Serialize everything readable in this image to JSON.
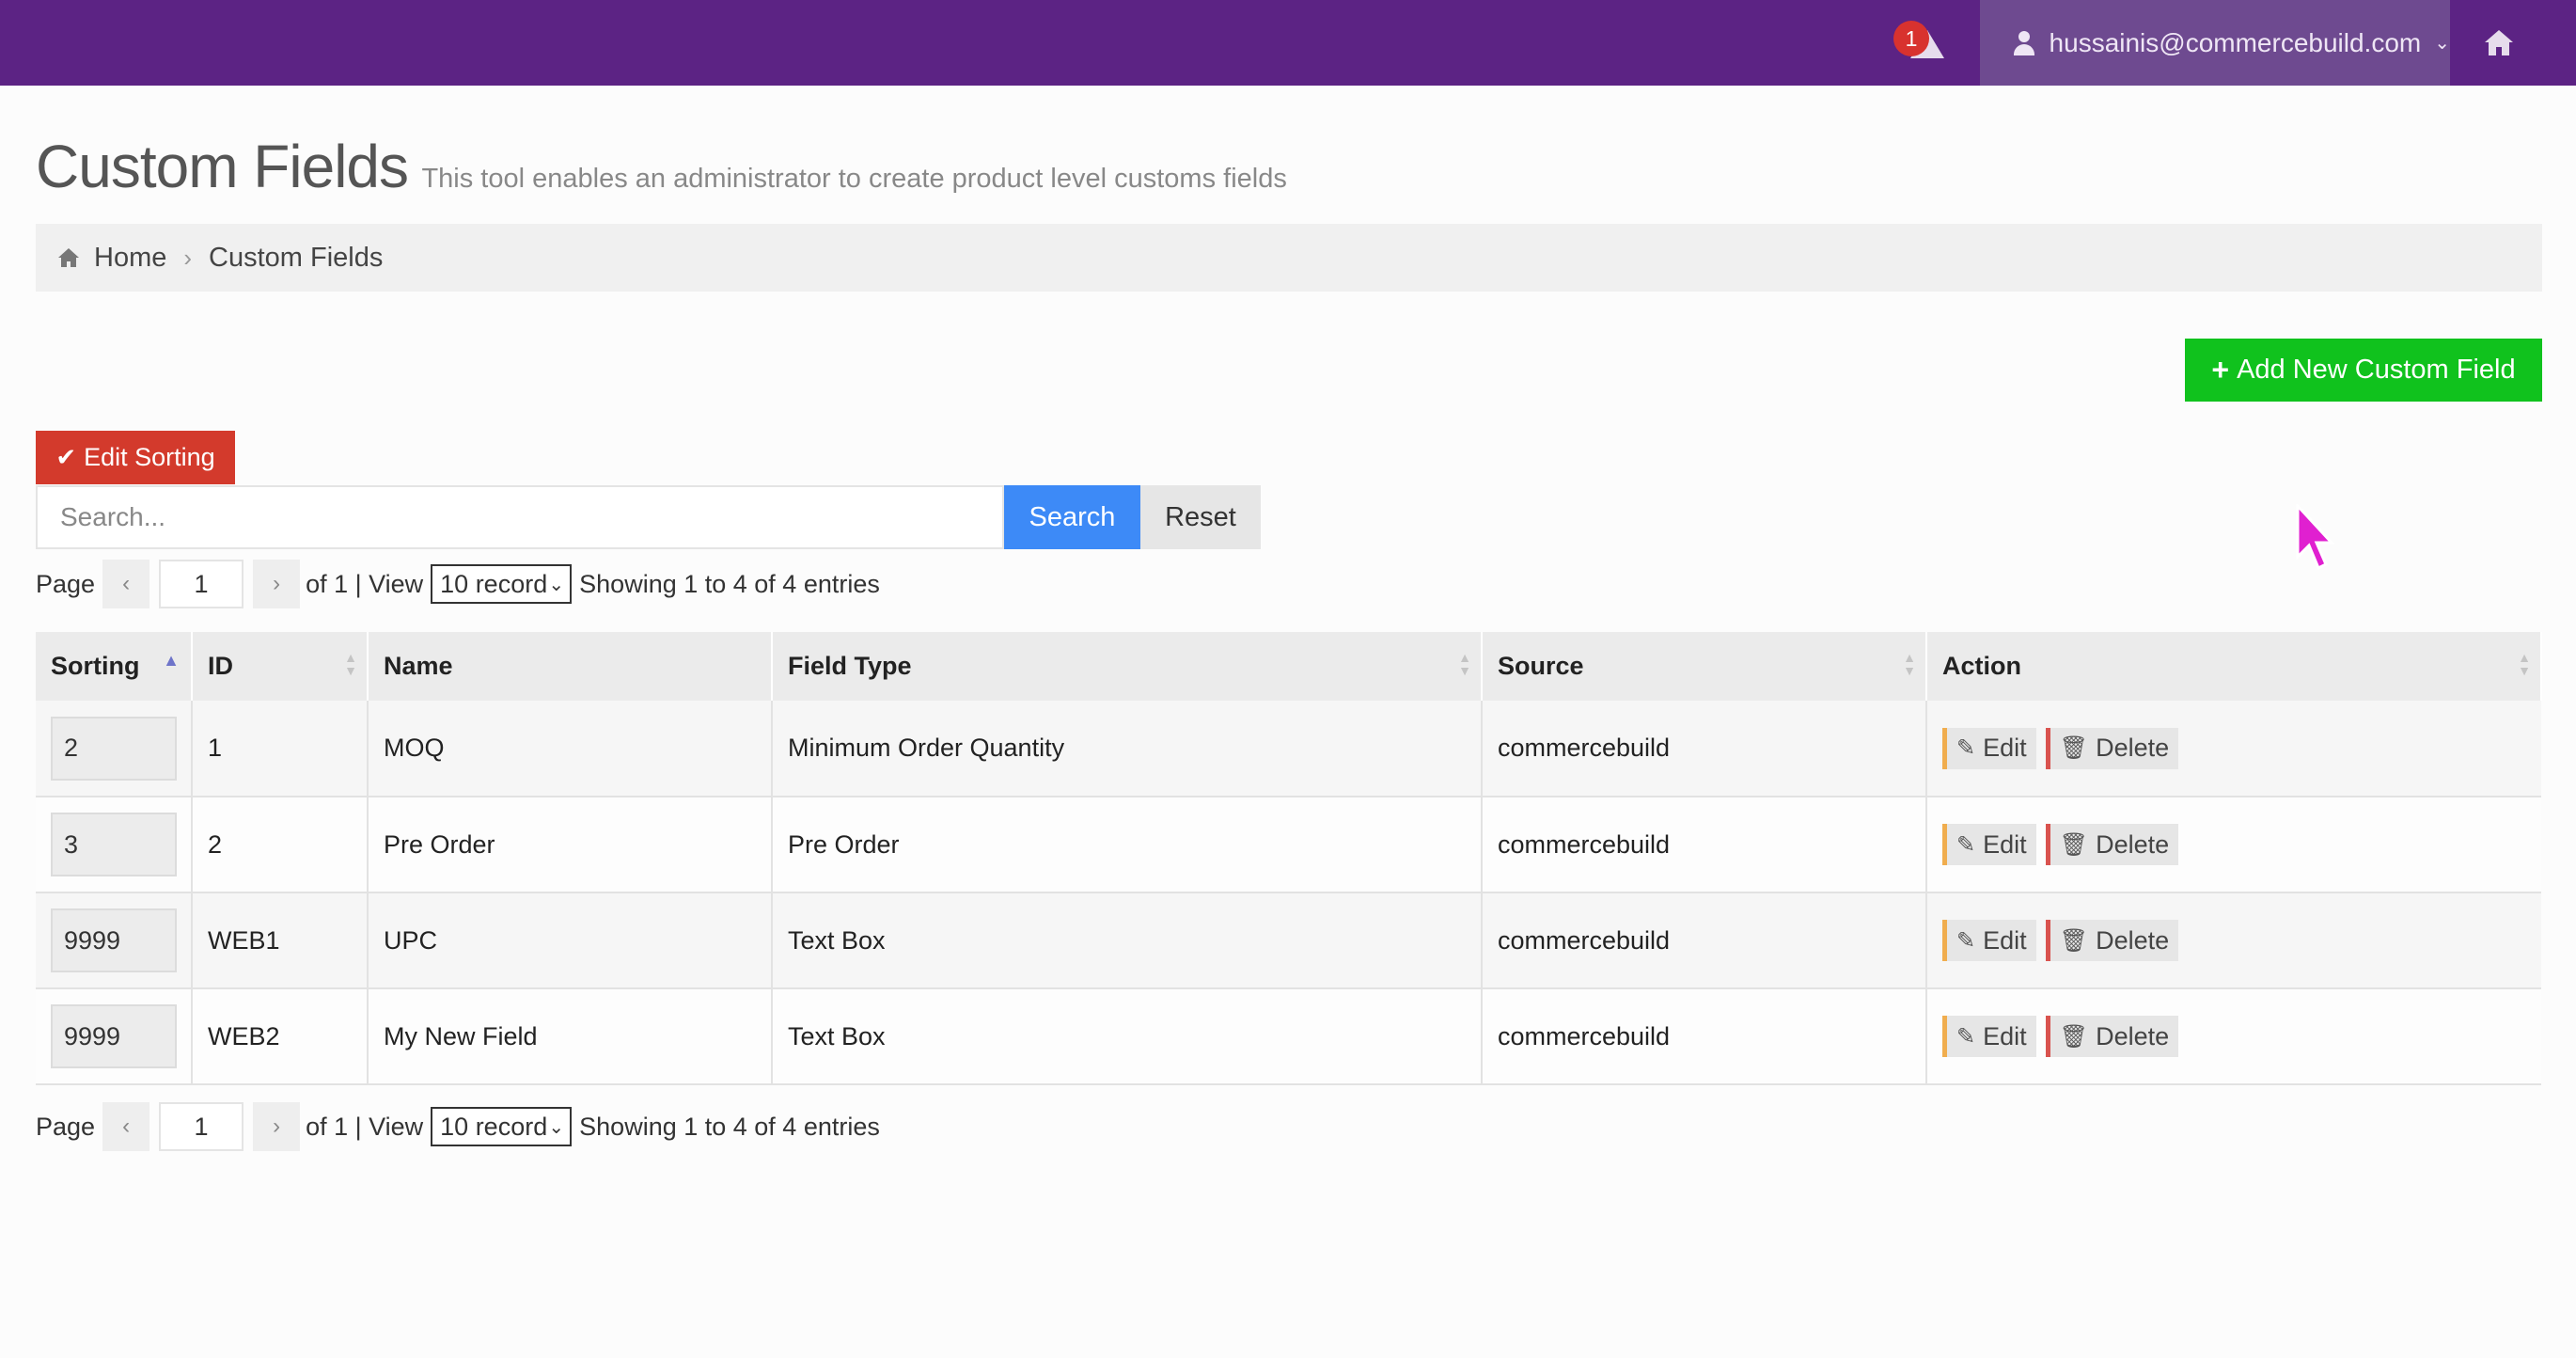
{
  "topbar": {
    "notification_count": "1",
    "user_email": "hussainis@commercebuild.com"
  },
  "page": {
    "title": "Custom Fields",
    "subtitle": "This tool enables an administrator to create product level customs fields"
  },
  "breadcrumb": {
    "home": "Home",
    "current": "Custom Fields"
  },
  "toolbar": {
    "add_label": "Add New Custom Field",
    "edit_sorting_label": "Edit Sorting",
    "search_placeholder": "Search...",
    "search_label": "Search",
    "reset_label": "Reset"
  },
  "pager": {
    "page_label": "Page",
    "prev": "‹",
    "next": "›",
    "current_page": "1",
    "of_text": "of 1 | View",
    "records_option": "10 records",
    "showing_text": "Showing 1 to 4 of 4 entries"
  },
  "table": {
    "columns": [
      "Sorting",
      "ID",
      "Name",
      "Field Type",
      "Source",
      "Action"
    ],
    "rows": [
      {
        "sorting": "2",
        "id": "1",
        "name": "MOQ",
        "field_type": "Minimum Order Quantity",
        "source": "commercebuild"
      },
      {
        "sorting": "3",
        "id": "2",
        "name": "Pre Order",
        "field_type": "Pre Order",
        "source": "commercebuild"
      },
      {
        "sorting": "9999",
        "id": "WEB1",
        "name": "UPC",
        "field_type": "Text Box",
        "source": "commercebuild"
      },
      {
        "sorting": "9999",
        "id": "WEB2",
        "name": "My New Field",
        "field_type": "Text Box",
        "source": "commercebuild"
      }
    ],
    "edit_label": "Edit",
    "delete_label": "Delete"
  },
  "colors": {
    "topbar": "#5c2384",
    "add_button": "#10c21d",
    "edit_sorting_button": "#d33a2c",
    "search_button": "#3d8af7",
    "cursor": "#e020d0"
  }
}
